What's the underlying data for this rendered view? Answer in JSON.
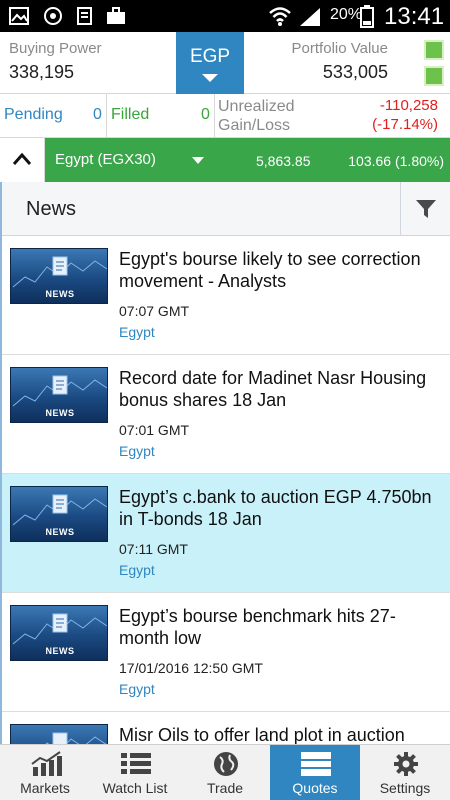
{
  "status_bar": {
    "battery_percent": "20%",
    "time": "13:41",
    "icons": [
      "gallery-icon",
      "sync-icon",
      "document-icon",
      "briefcase-icon",
      "wifi-icon",
      "signal-icon",
      "battery-icon"
    ]
  },
  "summary": {
    "buying_power_label": "Buying Power",
    "buying_power_value": "338,195",
    "currency": "EGP",
    "portfolio_value_label": "Portfolio Value",
    "portfolio_value": "533,005",
    "indicator_color": "#6cc24a"
  },
  "orders": {
    "pending_label": "Pending",
    "pending_count": "0",
    "filled_label": "Filled",
    "filled_count": "0",
    "unrealized_label": "Unrealized Gain/Loss",
    "unrealized_value": "-110,258",
    "unrealized_pct": "(-17.14%)"
  },
  "index": {
    "name": "Egypt (EGX30)",
    "value": "5,863.85",
    "change": "103.66 (1.80%)",
    "color": "#3aa64a"
  },
  "news": {
    "title": "News",
    "thumb_label": "NEWS",
    "items": [
      {
        "headline": "Egypt's bourse likely to see correction movement - Analysts",
        "time": "07:07 GMT",
        "tag": "Egypt"
      },
      {
        "headline": "Record date for Madinet Nasr Housing bonus shares 18 Jan",
        "time": "07:01 GMT",
        "tag": "Egypt"
      },
      {
        "headline": "Egypt’s c.bank to auction EGP 4.750bn in T-bonds 18 Jan",
        "time": "07:11 GMT",
        "tag": "Egypt"
      },
      {
        "headline": "Egypt’s bourse benchmark hits 27-month low",
        "time": "17/01/2016 12:50 GMT",
        "tag": "Egypt"
      },
      {
        "headline": "Misr Oils to offer land plot in auction",
        "time": "",
        "tag": ""
      }
    ]
  },
  "nav": {
    "items": [
      {
        "label": "Markets",
        "icon": "chart-icon"
      },
      {
        "label": "Watch List",
        "icon": "list-icon"
      },
      {
        "label": "Trade",
        "icon": "globe-icon"
      },
      {
        "label": "Quotes",
        "icon": "quotes-icon"
      },
      {
        "label": "Settings",
        "icon": "gear-icon"
      }
    ],
    "active_color": "#2f86c0"
  }
}
